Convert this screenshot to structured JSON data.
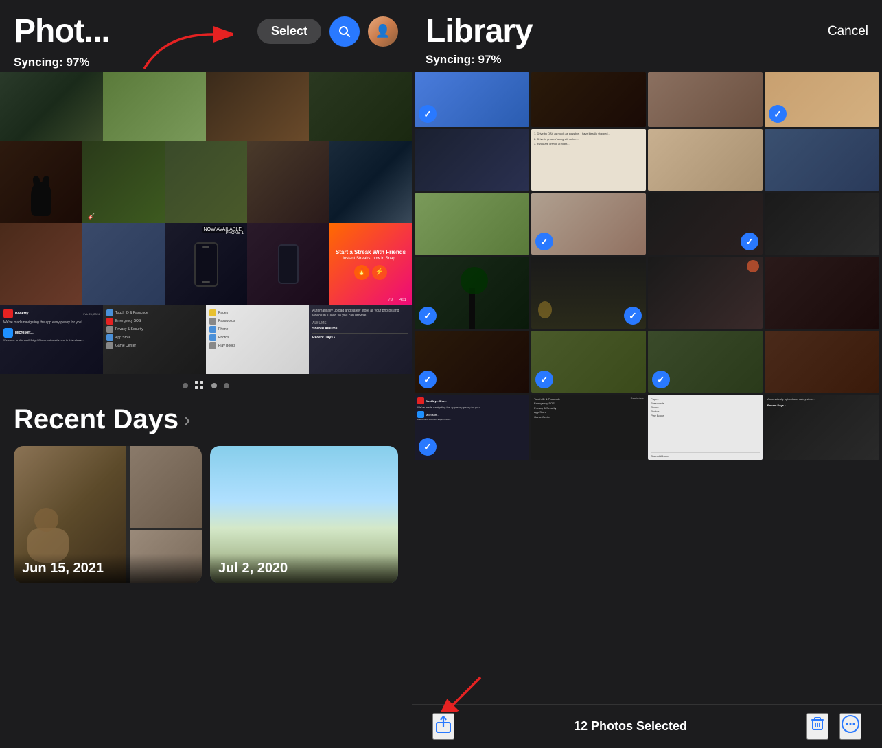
{
  "left": {
    "title": "Phot...",
    "syncing": "Syncing: 97%",
    "select_label": "Select",
    "pagination": {
      "dots": [
        "inactive",
        "active-grid",
        "inactive",
        "inactive"
      ]
    },
    "recent_days": {
      "title": "Recent Days",
      "chevron": "›",
      "cards": [
        {
          "date": "Jun 15, 2021"
        },
        {
          "date": "Jul 2, 2020"
        }
      ]
    }
  },
  "right": {
    "title": "Library",
    "syncing": "Syncing: 97%",
    "cancel_label": "Cancel",
    "selected_count": "12 Photos Selected",
    "photos_checked": [
      0,
      1,
      3,
      5,
      6,
      8,
      9,
      10,
      12,
      13,
      14,
      15
    ]
  }
}
